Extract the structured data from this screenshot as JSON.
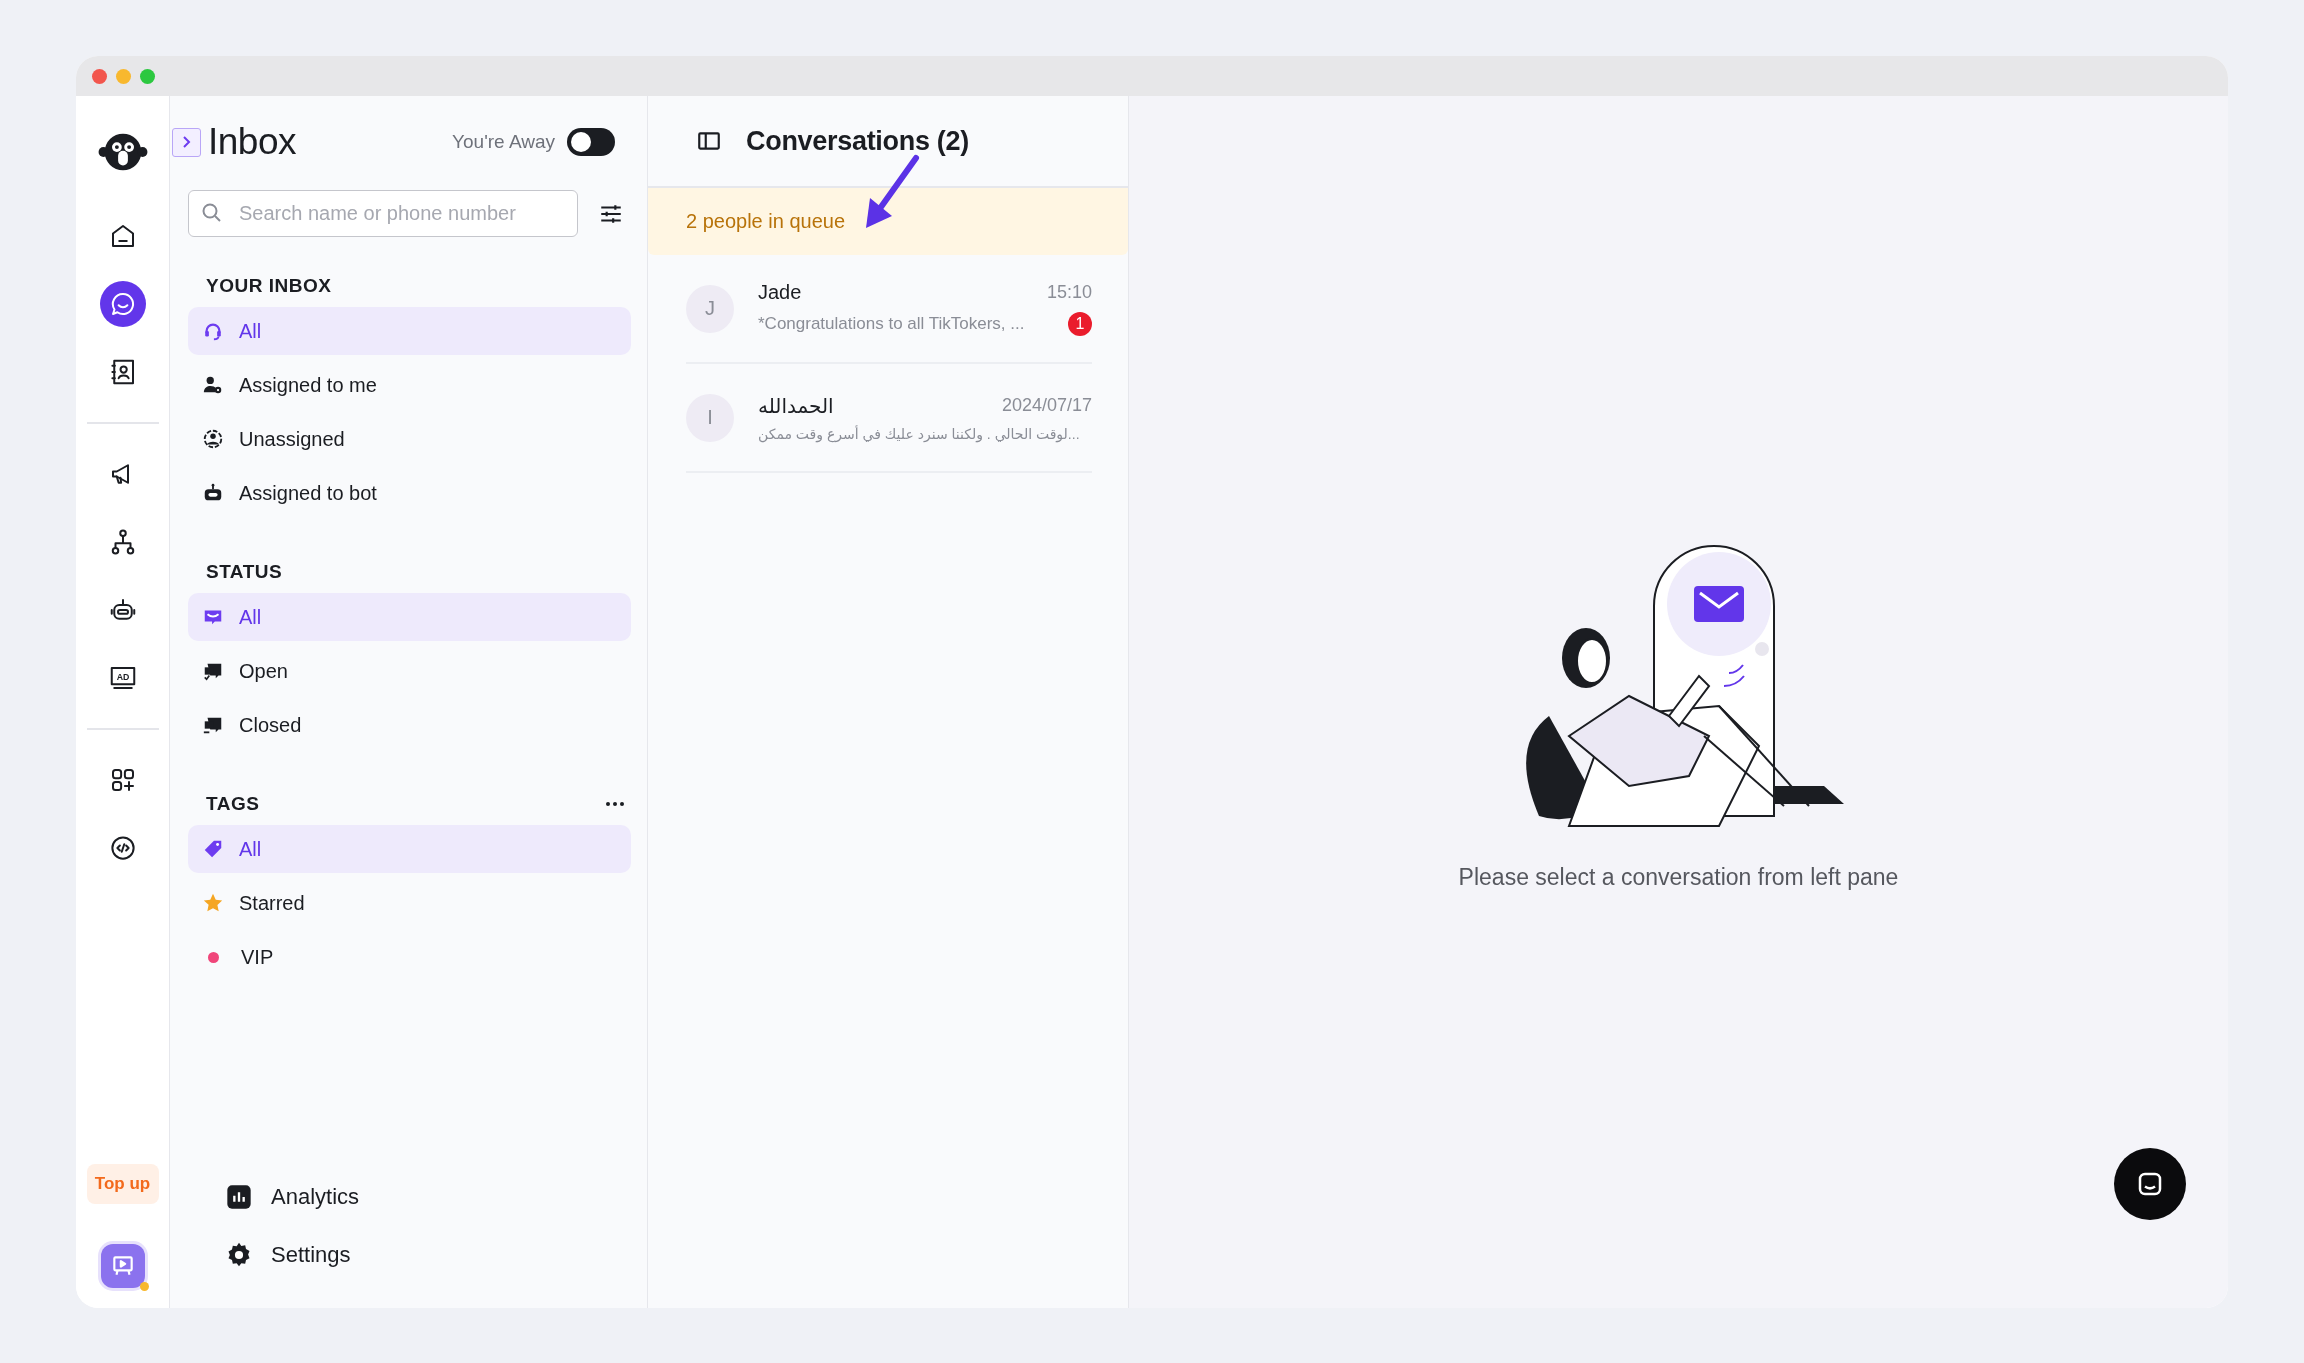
{
  "rail": {
    "items": [
      {
        "kind": "home",
        "selected": false
      },
      {
        "kind": "chat",
        "selected": true
      },
      {
        "kind": "contacts",
        "selected": false
      },
      {
        "kind": "divider"
      },
      {
        "kind": "megaphone",
        "selected": false
      },
      {
        "kind": "flow",
        "selected": false
      },
      {
        "kind": "bot",
        "selected": false
      },
      {
        "kind": "ad",
        "label": "AD",
        "selected": false
      },
      {
        "kind": "divider"
      },
      {
        "kind": "apps",
        "selected": false
      },
      {
        "kind": "code",
        "selected": false
      }
    ],
    "top_up": "Top up"
  },
  "inbox": {
    "title": "Inbox",
    "away_label": "You're Away",
    "away_on": false,
    "search": {
      "placeholder": "Search name or phone number"
    },
    "sections": [
      {
        "title": "YOUR INBOX",
        "items": [
          {
            "label": "All",
            "kind": "headset",
            "selected": true
          },
          {
            "label": "Assigned to me",
            "kind": "person-gear",
            "selected": false
          },
          {
            "label": "Unassigned",
            "kind": "person-ring",
            "selected": false
          },
          {
            "label": "Assigned to bot",
            "kind": "bot",
            "selected": false
          }
        ]
      },
      {
        "title": "STATUS",
        "items": [
          {
            "label": "All",
            "kind": "mail",
            "selected": true
          },
          {
            "label": "Open",
            "kind": "open",
            "selected": false
          },
          {
            "label": "Closed",
            "kind": "closed",
            "selected": false
          }
        ]
      },
      {
        "title": "TAGS",
        "more": true,
        "items": [
          {
            "label": "All",
            "kind": "tag",
            "selected": true
          },
          {
            "label": "Starred",
            "kind": "star",
            "selected": false
          },
          {
            "label": "VIP",
            "kind": "dot",
            "color": "#f0457a",
            "selected": false
          }
        ]
      }
    ],
    "footer": [
      {
        "label": "Analytics",
        "kind": "chart"
      },
      {
        "label": "Settings",
        "kind": "gear"
      }
    ]
  },
  "conversations": {
    "title": "Conversations (2)",
    "queue": "2 people in queue",
    "items": [
      {
        "initial": "J",
        "name": "Jade",
        "time": "15:10",
        "preview": "*Congratulations to all TikTokers, ...",
        "unread": "1"
      },
      {
        "initial": "I",
        "name": "الحمدالله",
        "time": "2024/07/17",
        "preview": "...لوقت الحالي . ولكننا سنرد عليك في أسرع وقت ممكن"
      }
    ]
  },
  "empty": {
    "message": "Please select a conversation from left pane"
  }
}
